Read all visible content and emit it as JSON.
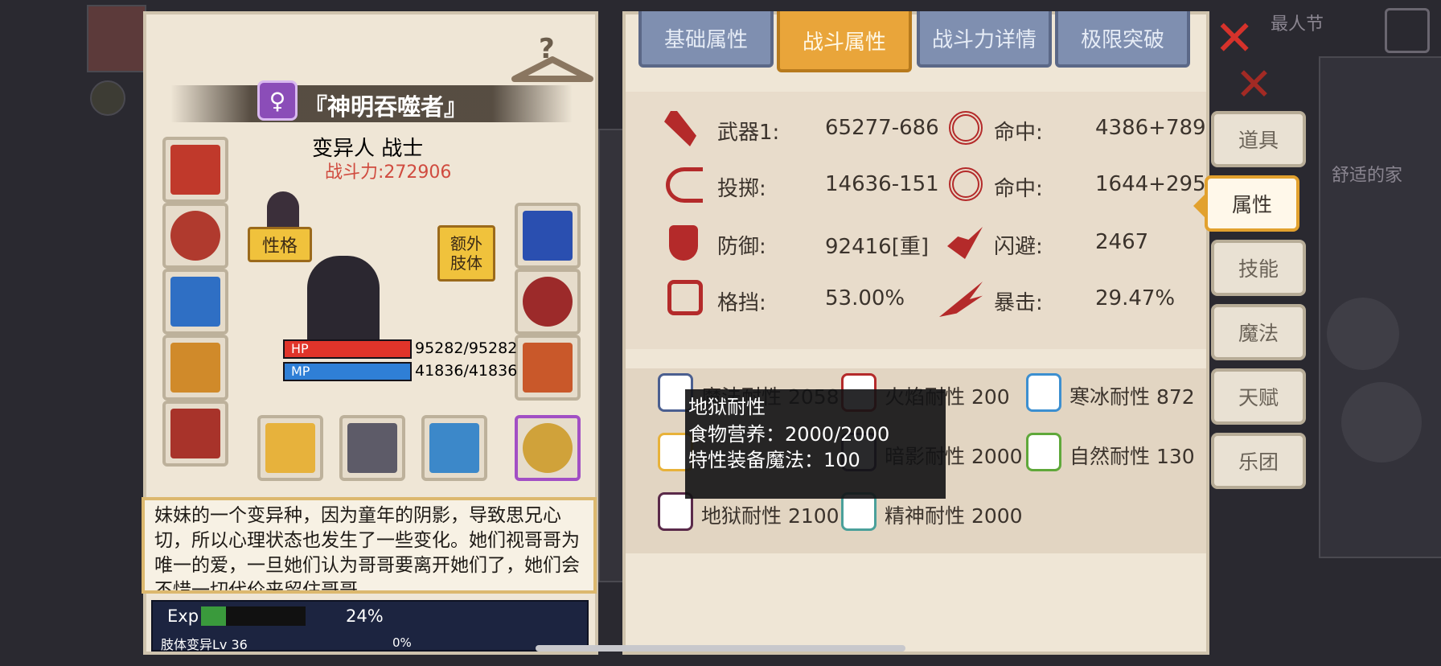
{
  "character": {
    "name": "『神明吞噬者』",
    "gender_symbol": "♀",
    "race_class": "变异人 战士",
    "power": "战斗力:272906",
    "trait_button": "性格",
    "extra_limb_button": "额外\n肢体",
    "hp_label": "HP",
    "hp_value": "95282/95282",
    "mp_label": "MP",
    "mp_value": "41836/41836",
    "description": "妹妹的一个变异种，因为童年的阴影，导致思兄心切，所以心理状态也发生了一些变化。她们视哥哥为唯一的爱，一旦她们认为哥哥要离开她们了，她们会不惜一切代价来留住哥哥",
    "exp_label": "Exp",
    "exp_percent": "24%",
    "exp_fraction": 0.24,
    "limb_label": "肢体变异Lv 36",
    "limb_percent": "0%",
    "limb_fraction": 0
  },
  "tabs": [
    {
      "label": "基础属性",
      "active": false
    },
    {
      "label": "战斗属性",
      "active": true
    },
    {
      "label": "战斗力详情",
      "active": false
    },
    {
      "label": "极限突破",
      "active": false
    }
  ],
  "side_menu": [
    {
      "label": "道具",
      "active": false
    },
    {
      "label": "属性",
      "active": true
    },
    {
      "label": "技能",
      "active": false
    },
    {
      "label": "魔法",
      "active": false
    },
    {
      "label": "天赋",
      "active": false
    },
    {
      "label": "乐团",
      "active": false
    }
  ],
  "stats": {
    "weapon_label": "武器1:",
    "weapon_value": "65277-686",
    "hit1_label": "命中:",
    "hit1_value": "4386+789",
    "throw_label": "投掷:",
    "throw_value": "14636-151",
    "hit2_label": "命中:",
    "hit2_value": "1644+295",
    "defense_label": "防御:",
    "defense_value": "92416[重]",
    "dodge_label": "闪避:",
    "dodge_value": "2467",
    "block_label": "格挡:",
    "block_value": "53.00%",
    "crit_label": "暴击:",
    "crit_value": "29.47%"
  },
  "resistances": {
    "magic": "魔法耐性 2058",
    "fire": "火焰耐性 200",
    "ice": "寒冰耐性 872",
    "lightning": "",
    "shadow": "暗影耐性 2000",
    "nature": "自然耐性 130",
    "hell": "地狱耐性 2100",
    "spirit": "精神耐性 2000"
  },
  "tooltip": {
    "title": "地狱耐性",
    "line1": "食物营养：2000/2000",
    "line2": "特性装备魔法：100"
  },
  "background_texts": {
    "top_right": "最人节",
    "house": "舒适的家"
  },
  "colors": {
    "hp": "#e0342a",
    "mp": "#2f7fd6",
    "exp": "#3a9a3c",
    "accent": "#e9a53a",
    "power": "#d04b3f"
  }
}
